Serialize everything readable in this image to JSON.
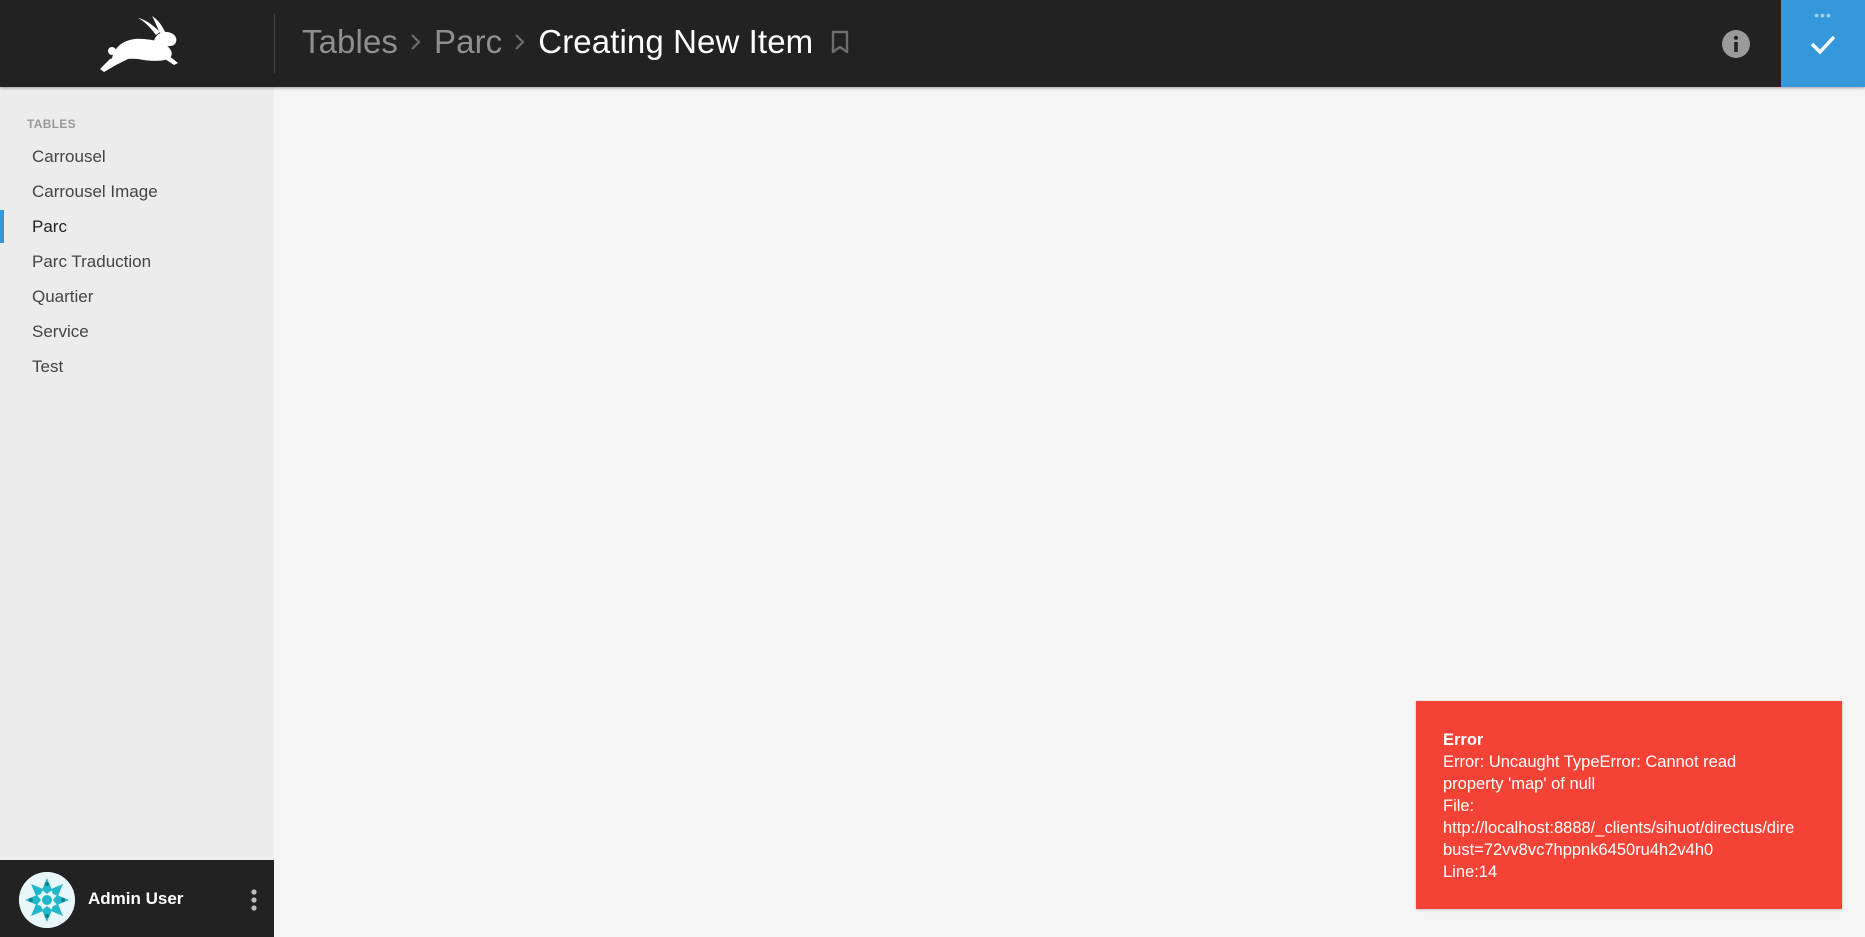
{
  "header": {
    "logo_icon": "rabbit-logo-icon",
    "breadcrumb": {
      "items": [
        "Tables",
        "Parc"
      ],
      "current": "Creating New Item"
    },
    "bookmark_icon": "bookmark-icon",
    "info_icon": "info-icon",
    "save_icon": "checkmark-icon",
    "more_icon": "more-horizontal-icon",
    "colors": {
      "bar": "#222222",
      "accent": "#3498db"
    }
  },
  "sidebar": {
    "heading": "TABLES",
    "items": [
      {
        "label": "Carrousel",
        "active": false
      },
      {
        "label": "Carrousel Image",
        "active": false
      },
      {
        "label": "Parc",
        "active": true
      },
      {
        "label": "Parc Traduction",
        "active": false
      },
      {
        "label": "Quartier",
        "active": false
      },
      {
        "label": "Service",
        "active": false
      },
      {
        "label": "Test",
        "active": false
      }
    ]
  },
  "user": {
    "name": "Admin User",
    "avatar_icon": "snowflake-avatar",
    "menu_icon": "more-vertical-icon"
  },
  "error": {
    "title": "Error",
    "lines": [
      "Error: Uncaught TypeError: Cannot read",
      "property 'map' of null",
      "File:",
      "http://localhost:8888/_clients/sihuot/directus/dire",
      "bust=72vv8vc7hppnk6450ru4h2v4h0",
      "Line:14"
    ],
    "color": "#f44336"
  }
}
